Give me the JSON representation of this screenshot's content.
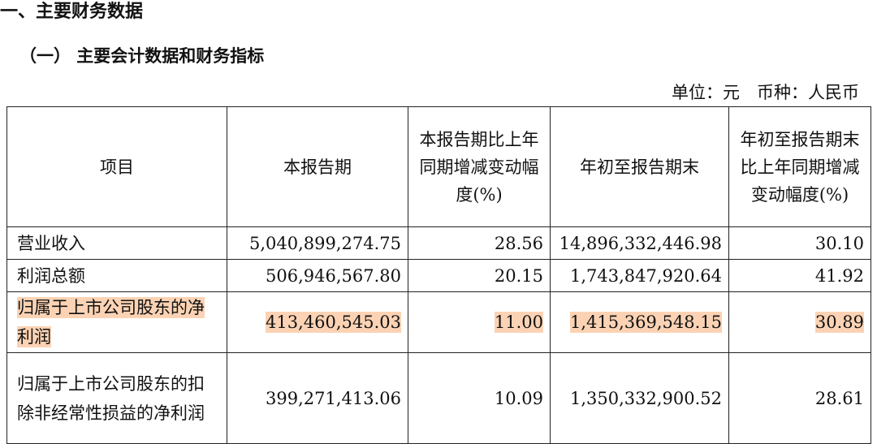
{
  "title": "一、主要财务数据",
  "subtitle": "（一） 主要会计数据和财务指标",
  "unit_line": "单位：元　币种：人民币",
  "table": {
    "headers": [
      "项目",
      "本报告期",
      "本报告期比上年同期增减变动幅度(%)",
      "年初至报告期末",
      "年初至报告期末比上年同期增减变动幅度(%)"
    ],
    "rows": [
      {
        "item": "营业收入",
        "current": "5,040,899,274.75",
        "current_change": "28.56",
        "ytd": "14,896,332,446.98",
        "ytd_change": "30.10",
        "highlight": false
      },
      {
        "item": "利润总额",
        "current": "506,946,567.80",
        "current_change": "20.15",
        "ytd": "1,743,847,920.64",
        "ytd_change": "41.92",
        "highlight": false
      },
      {
        "item": "归属于上市公司股东的净利润",
        "current": "413,460,545.03",
        "current_change": "11.00",
        "ytd": "1,415,369,548.15",
        "ytd_change": "30.89",
        "highlight": true
      },
      {
        "item": "归属于上市公司股东的扣除非经常性损益的净利润",
        "current": "399,271,413.06",
        "current_change": "10.09",
        "ytd": "1,350,332,900.52",
        "ytd_change": "28.61",
        "highlight": false
      }
    ]
  },
  "highlight_color": "#fbd3b4"
}
